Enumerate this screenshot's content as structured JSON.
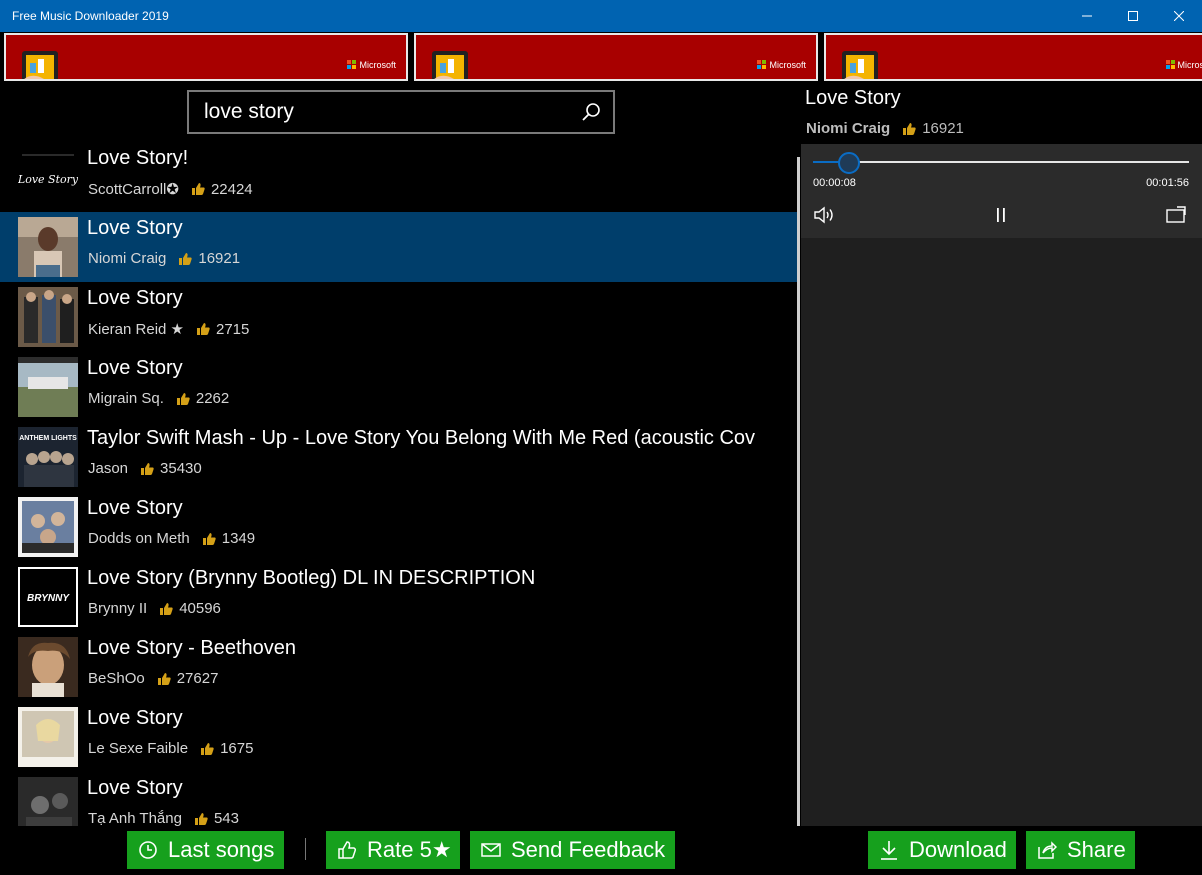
{
  "window": {
    "title": "Free Music Downloader 2019",
    "controls": [
      "minimize-icon",
      "maximize-icon",
      "close-icon"
    ]
  },
  "ads": [
    {
      "brand": "Microsoft"
    },
    {
      "brand": "Microsoft"
    },
    {
      "brand": "Micros"
    }
  ],
  "search": {
    "query": "love story",
    "icon": "search-icon"
  },
  "results": [
    {
      "title": "Love Story!",
      "artist": "ScottCarroll✪",
      "likes": "22424",
      "selected": false
    },
    {
      "title": "Love Story",
      "artist": "Niomi Craig",
      "likes": "16921",
      "selected": true
    },
    {
      "title": "Love Story",
      "artist": "Kieran Reid ★",
      "likes": "2715",
      "selected": false
    },
    {
      "title": "Love Story",
      "artist": "Migrain Sq.",
      "likes": "2262",
      "selected": false
    },
    {
      "title": "Taylor Swift Mash - Up -  Love Story   You Belong With Me   Red  (acoustic Cov",
      "artist": "Jason",
      "likes": "35430",
      "selected": false
    },
    {
      "title": "Love Story",
      "artist": "Dodds on Meth",
      "likes": "1349",
      "selected": false
    },
    {
      "title": "Love Story (Brynny Bootleg) DL IN DESCRIPTION",
      "artist": "Brynny II",
      "likes": "40596",
      "selected": false
    },
    {
      "title": "Love Story - Beethoven",
      "artist": "BeShOo",
      "likes": "27627",
      "selected": false
    },
    {
      "title": "Love Story",
      "artist": "Le Sexe Faible",
      "likes": "1675",
      "selected": false
    },
    {
      "title": "Love Story",
      "artist": "Tạ Anh Thắng",
      "likes": "543",
      "selected": false
    }
  ],
  "thumb_text": {
    "row0": "Love Story",
    "row4": "ANTHEM LIGHTS",
    "row6": "BRYNNY"
  },
  "player": {
    "title": "Love Story",
    "artist": "Niomi Craig",
    "likes": "16921",
    "current_time": "00:00:08",
    "total_time": "00:01:56",
    "progress": 0.069,
    "icons": [
      "volume-icon",
      "pause-icon",
      "cast-icon"
    ]
  },
  "bottom_bar": {
    "last_songs": "Last songs",
    "rate": "Rate 5★",
    "feedback": "Send Feedback",
    "download": "Download",
    "share": "Share"
  },
  "colors": {
    "titlebar": "#0063b1",
    "selected_row": "#003e6b",
    "button_green": "#16a01d",
    "ad_red": "#a80000",
    "like_gold": "#d4a017"
  }
}
